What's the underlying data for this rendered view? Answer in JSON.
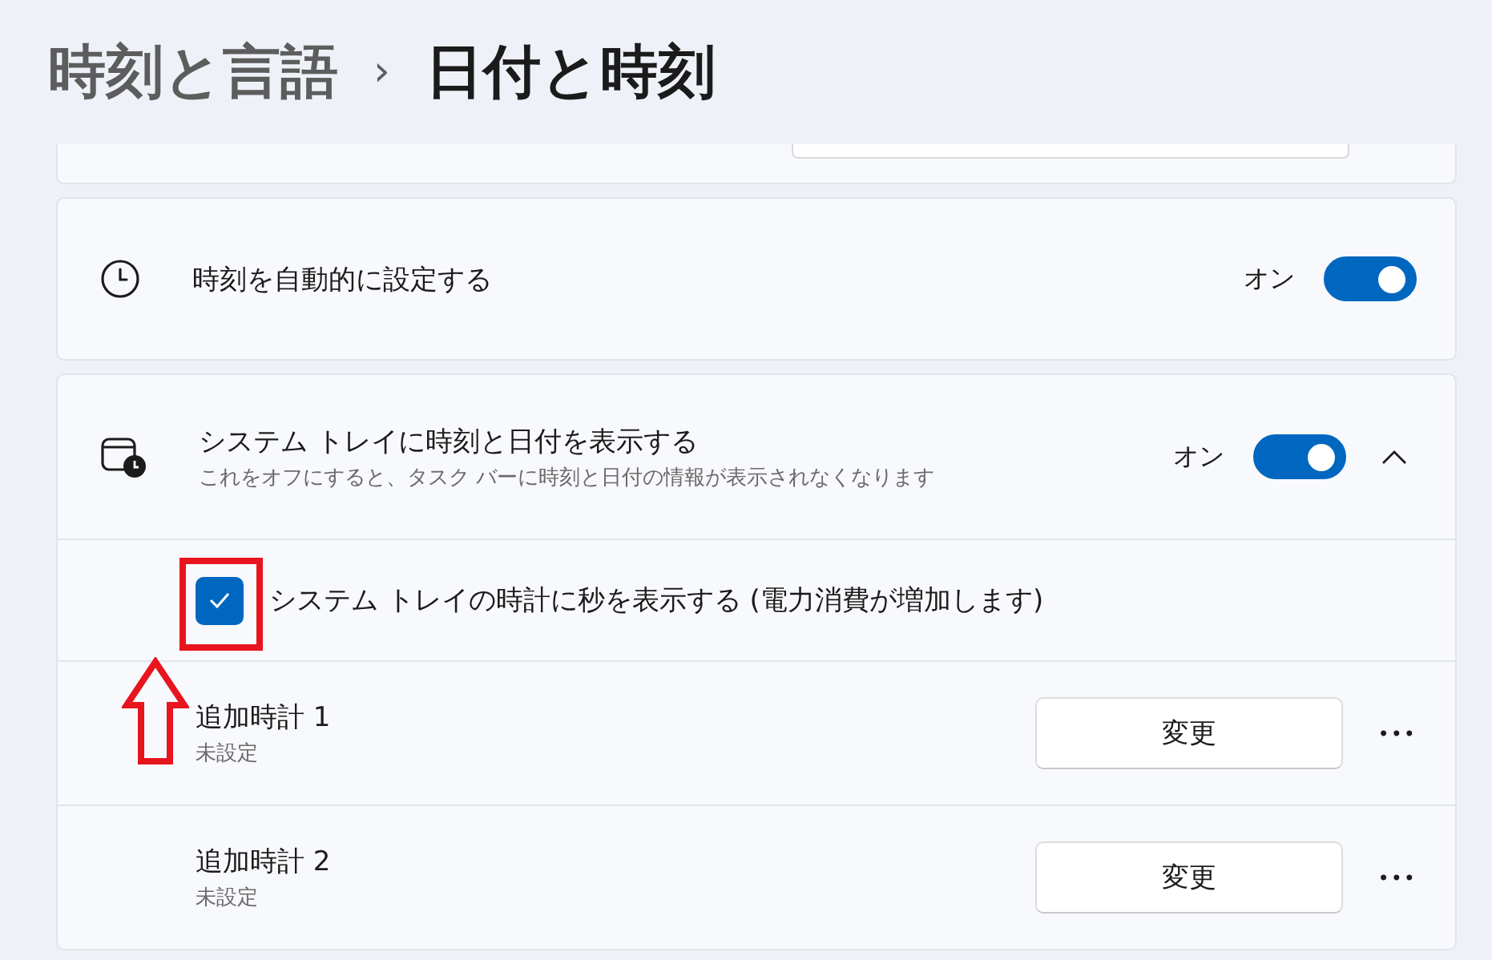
{
  "breadcrumb": {
    "parent": "時刻と言語",
    "separator": "›",
    "current": "日付と時刻"
  },
  "auto_time": {
    "title": "時刻を自動的に設定する",
    "state_label": "オン",
    "on": true
  },
  "tray": {
    "title": "システム トレイに時刻と日付を表示する",
    "description": "これをオフにすると、タスク バーに時刻と日付の情報が表示されなくなります",
    "state_label": "オン",
    "on": true,
    "expanded": true,
    "seconds": {
      "label": "システム トレイの時計に秒を表示する (電力消費が増加します)",
      "checked": true
    },
    "clocks": [
      {
        "title": "追加時計 1",
        "status": "未設定",
        "button": "変更",
        "more": "•••"
      },
      {
        "title": "追加時計 2",
        "status": "未設定",
        "button": "変更",
        "more": "•••"
      }
    ]
  },
  "annotation": {
    "highlight": true
  }
}
